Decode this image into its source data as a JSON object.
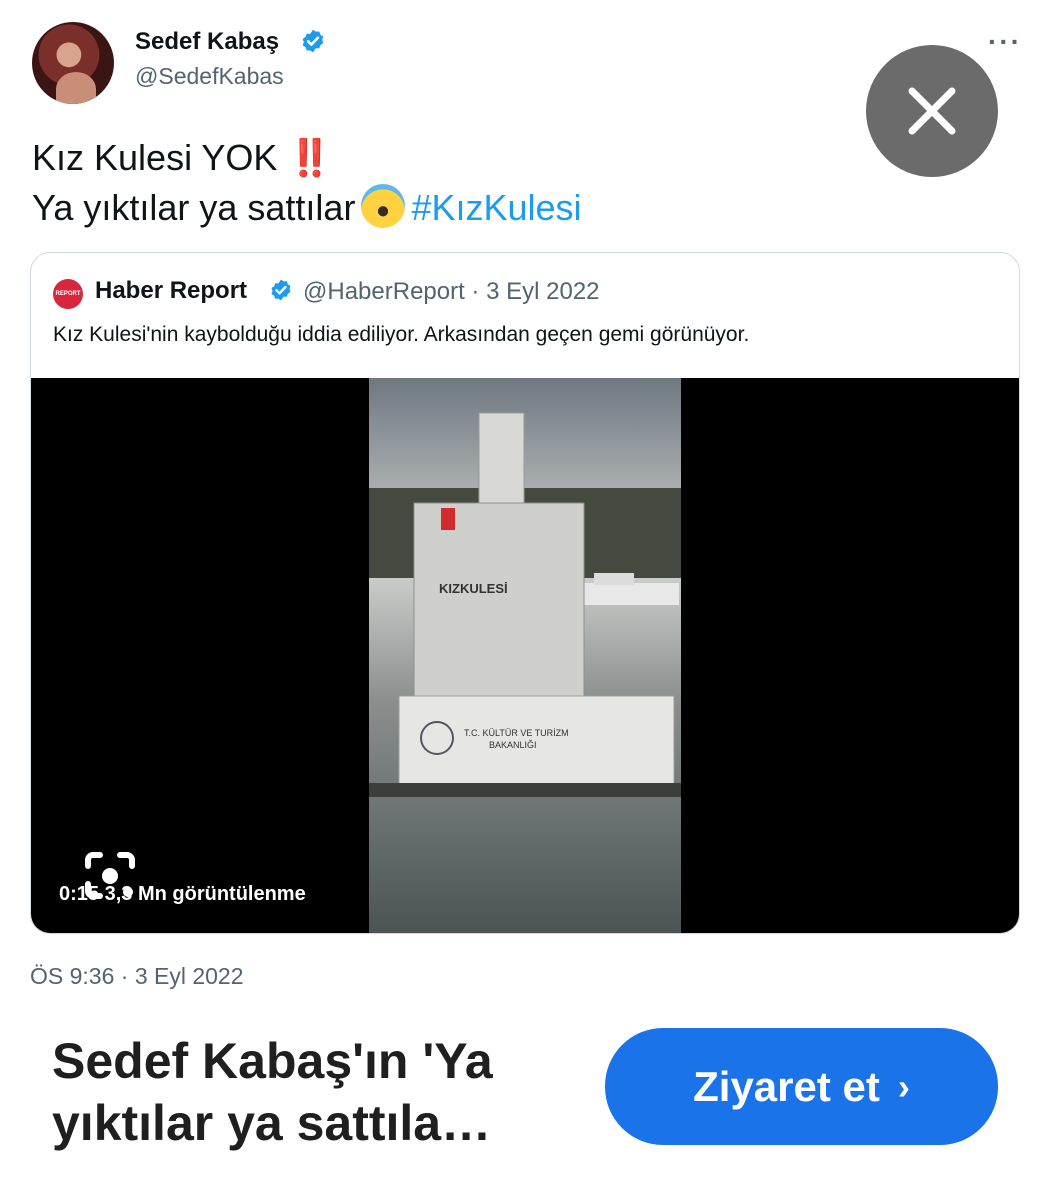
{
  "tweet": {
    "author_name": "Sedef Kabaş",
    "author_handle": "@SedefKabas",
    "more": "···",
    "text_line1": "Kız Kulesi YOK",
    "text_line1_suffix": "‼️",
    "text_line2": "Ya yıktılar ya sattılar",
    "hashtag": "#KızKulesi",
    "timestamp": "ÖS 9:36 · 3 Eyl 2022"
  },
  "quote": {
    "avatar_label": "REPORT",
    "author_name": "Haber Report",
    "meta": "@HaberReport · 3 Eyl 2022",
    "text": "Kız Kulesi'nin kaybolduğu iddia ediliyor. Arkasından geçen gemi görünüyor.",
    "video_overlay": "0:15  3,3 Mn görüntülenme",
    "video_signage": {
      "tower_label": "KIZKULESİ",
      "banner_line1": "T.C. KÜLTÜR VE TURİZM",
      "banner_line2": "BAKANLIĞI"
    }
  },
  "footer": {
    "title": "Sedef Kabaş'ın 'Ya yıktılar ya sattıla…",
    "visit_label": "Ziyaret et",
    "visit_chevron": "›"
  },
  "icons": [
    "verified-badge-icon",
    "close-icon",
    "lens-search-icon",
    "chevron-right-icon"
  ],
  "colors": {
    "link": "#1d9bf0",
    "button": "#1a73e8",
    "close_bg": "#6b6b6b",
    "muted": "#536471"
  }
}
